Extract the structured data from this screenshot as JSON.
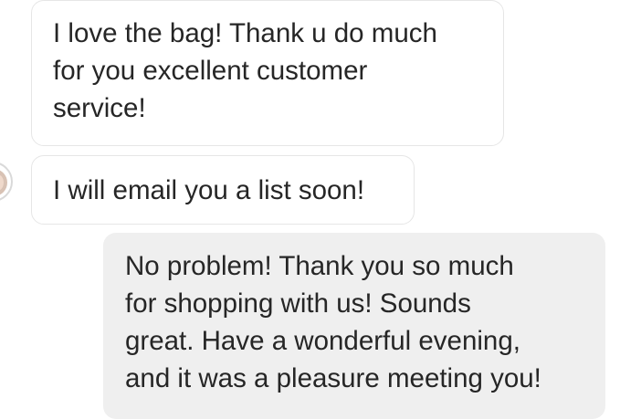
{
  "conversation": {
    "messages": [
      {
        "direction": "received",
        "text": "I love the bag! Thank u do much\nfor you excellent customer\nservice!"
      },
      {
        "direction": "received",
        "text": "I will email you a list soon!"
      },
      {
        "direction": "sent",
        "text": "No problem! Thank you so much\nfor shopping with us! Sounds\ngreat. Have a wonderful evening,\nand it was a pleasure meeting you!"
      }
    ]
  },
  "colors": {
    "received_bubble_bg": "#ffffff",
    "received_bubble_border": "#e6e6e6",
    "sent_bubble_bg": "#efefef",
    "text": "#262626"
  }
}
